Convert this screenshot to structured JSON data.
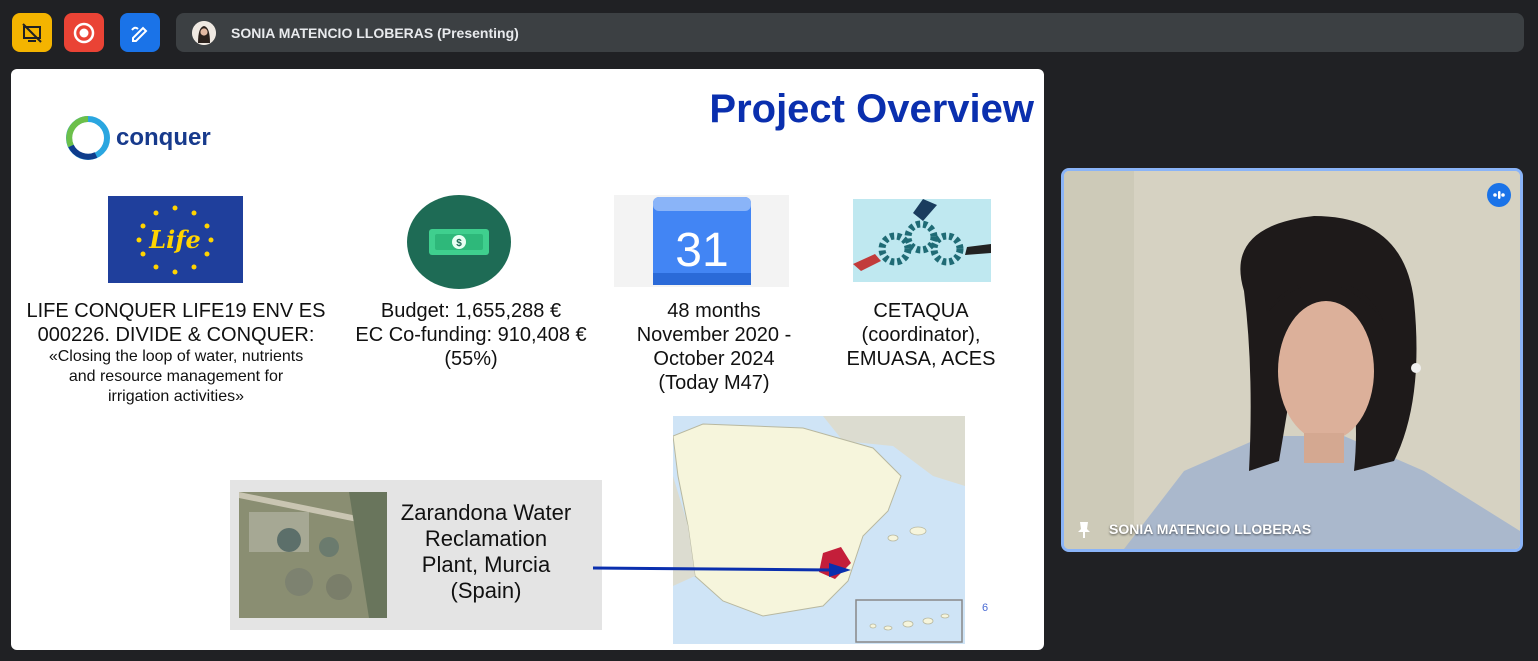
{
  "toolbar": {
    "buttons": [
      {
        "icon": "slash-screen-icon",
        "color": "#f4b400"
      },
      {
        "icon": "record-icon",
        "color": "#ea4335"
      },
      {
        "icon": "whiteboard-icon",
        "color": "#1a73e8"
      }
    ],
    "presenter_label": "SONIA MATENCIO LLOBERAS (Presenting)"
  },
  "slide": {
    "title": "Project Overview",
    "logo_text": "conquer",
    "columns": [
      {
        "lines": [
          "LIFE CONQUER LIFE19 ENV ES",
          "000226. DIVIDE & CONQUER:"
        ],
        "small_lines": [
          "«Closing the loop of water, nutrients",
          "and resource management for",
          "irrigation activities»"
        ]
      },
      {
        "lines": [
          "Budget: 1,655,288 €",
          "EC Co-funding: 910,408 €",
          "(55%)"
        ]
      },
      {
        "lines": [
          "48 months",
          "November 2020 -",
          "October 2024",
          "(Today M47)"
        ]
      },
      {
        "lines": [
          "CETAQUA",
          "(coordinator),",
          "EMUASA, ACES"
        ]
      }
    ],
    "calendar_day": "31",
    "eu_life_text": "Life",
    "dollar_symbol": "$",
    "plant_label": [
      "Zarandona Water",
      "Reclamation",
      "Plant, Murcia",
      "(Spain)"
    ],
    "page_number": "6"
  },
  "video": {
    "participant_name": "SONIA MATENCIO LLOBERAS"
  },
  "colors": {
    "title_blue": "#0a2fae",
    "bg": "#202124",
    "active_border": "#8ab4f8"
  }
}
